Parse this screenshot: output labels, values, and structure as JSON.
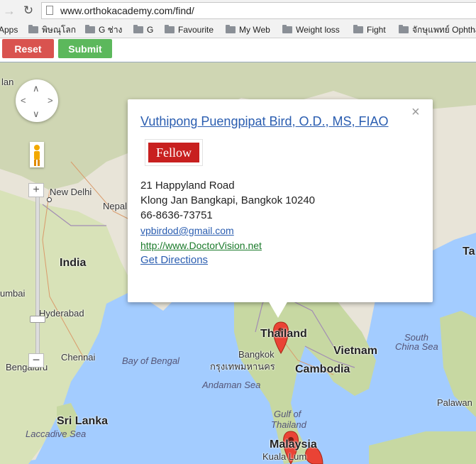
{
  "browser": {
    "url": "www.orthokacademy.com/find/",
    "back_icon": "back-arrow-icon",
    "reload_icon": "reload-icon",
    "bookmarks": [
      {
        "label": "Apps"
      },
      {
        "label": "พิษณุโลก"
      },
      {
        "label": "G ช่าง"
      },
      {
        "label": "G"
      },
      {
        "label": "Favourite"
      },
      {
        "label": "My Web"
      },
      {
        "label": "Weight loss"
      },
      {
        "label": "Fight"
      },
      {
        "label": "จักษุแพทย์ Ophtha"
      }
    ]
  },
  "toolbar": {
    "reset_label": "Reset",
    "submit_label": "Submit",
    "reset_color": "#d9534f",
    "submit_color": "#5cb85c"
  },
  "map": {
    "labels": {
      "lan": "lan",
      "delhi": "New Delhi",
      "nepal": "Nepal",
      "india": "India",
      "mumbai": "umbai",
      "hyderabad": "Hyderabad",
      "bengaluru": "Bengaluru",
      "chennai": "Chennai",
      "bay": "Bay of Bengal",
      "srilanka": "Sri Lanka",
      "laccadive": "Laccadive Sea",
      "thailand": "Thailand",
      "bangkok": "Bangkok",
      "bangkok_th": "กรุงเทพมหานคร",
      "cambodia": "Cambodia",
      "vietnam": "Vietnam",
      "andaman": "Andaman Sea",
      "gulf1": "Gulf of",
      "gulf2": "Thailand",
      "southchina1": "South",
      "southchina2": "China Sea",
      "ta": "Ta",
      "palawan": "Palawan",
      "malaysia": "Malaysia",
      "kuala": "Kuala Lum"
    }
  },
  "info_window": {
    "title": "Vuthipong Puengpipat Bird, O.D., MS, FIAO",
    "badge": "Fellow",
    "address1": "21 Happyland Road",
    "address2": "Klong Jan Bangkapi, Bangkok 10240",
    "phone": "66-8636-73751",
    "email": "vpbirdod@gmail.com",
    "website": "http://www.DoctorVision.net",
    "directions": "Get Directions",
    "close_symbol": "×",
    "link_color": "#2a5db0",
    "website_color": "#1a7a2a"
  }
}
